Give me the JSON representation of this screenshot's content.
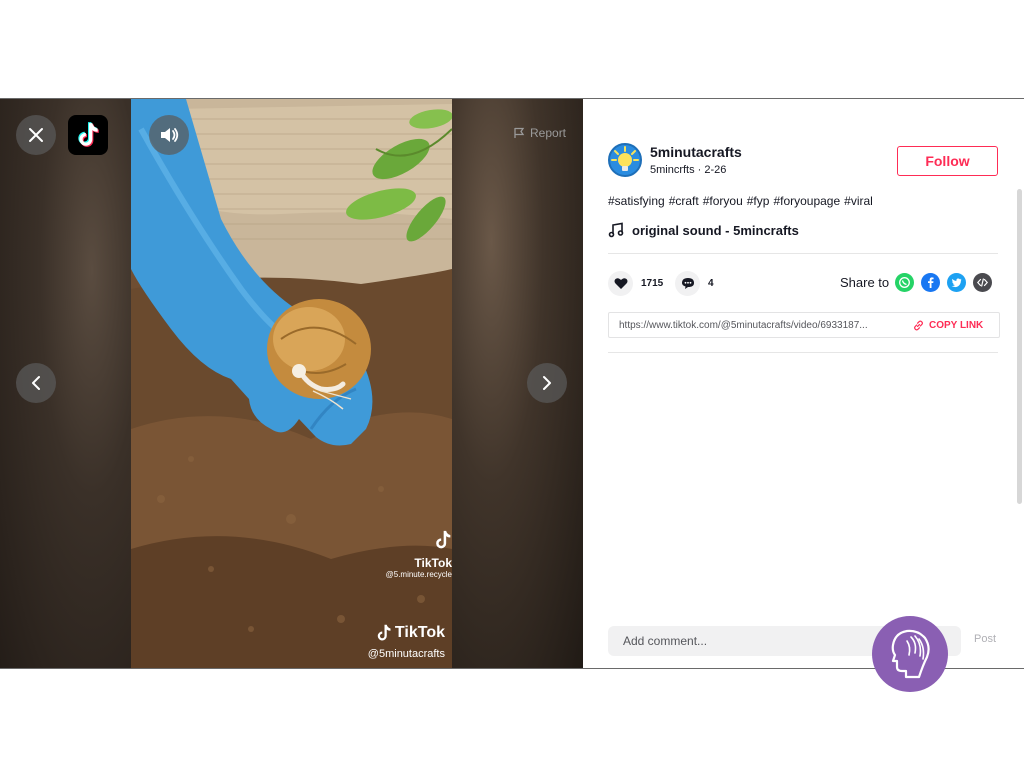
{
  "player": {
    "report_label": "Report",
    "watermark_small": {
      "brand": "TikTok",
      "handle": "@5.minute.recycle"
    },
    "watermark_big": {
      "brand": "TikTok",
      "handle": "@5minutacrafts"
    }
  },
  "author": {
    "display_name": "5minutacrafts",
    "meta": "5mincrfts · 2-26",
    "follow_label": "Follow"
  },
  "description": {
    "hashtags": [
      "#satisfying",
      "#craft",
      "#foryou",
      "#fyp",
      "#foryoupage",
      "#viral"
    ]
  },
  "sound": {
    "title": "original sound - 5mincrafts"
  },
  "stats": {
    "likes": "1715",
    "comments": "4"
  },
  "share": {
    "label": "Share to",
    "targets": [
      "whatsapp-icon",
      "facebook-icon",
      "twitter-icon",
      "embed-icon"
    ]
  },
  "link": {
    "url": "https://www.tiktok.com/@5minutacrafts/video/6933187...",
    "copy_label": "COPY LINK"
  },
  "comment": {
    "placeholder": "Add comment...",
    "post_label": "Post"
  },
  "colors": {
    "accent": "#fe2c55",
    "badge": "#8a5fb3",
    "whatsapp": "#25d366",
    "facebook": "#1877f2",
    "twitter": "#1da1f2"
  }
}
